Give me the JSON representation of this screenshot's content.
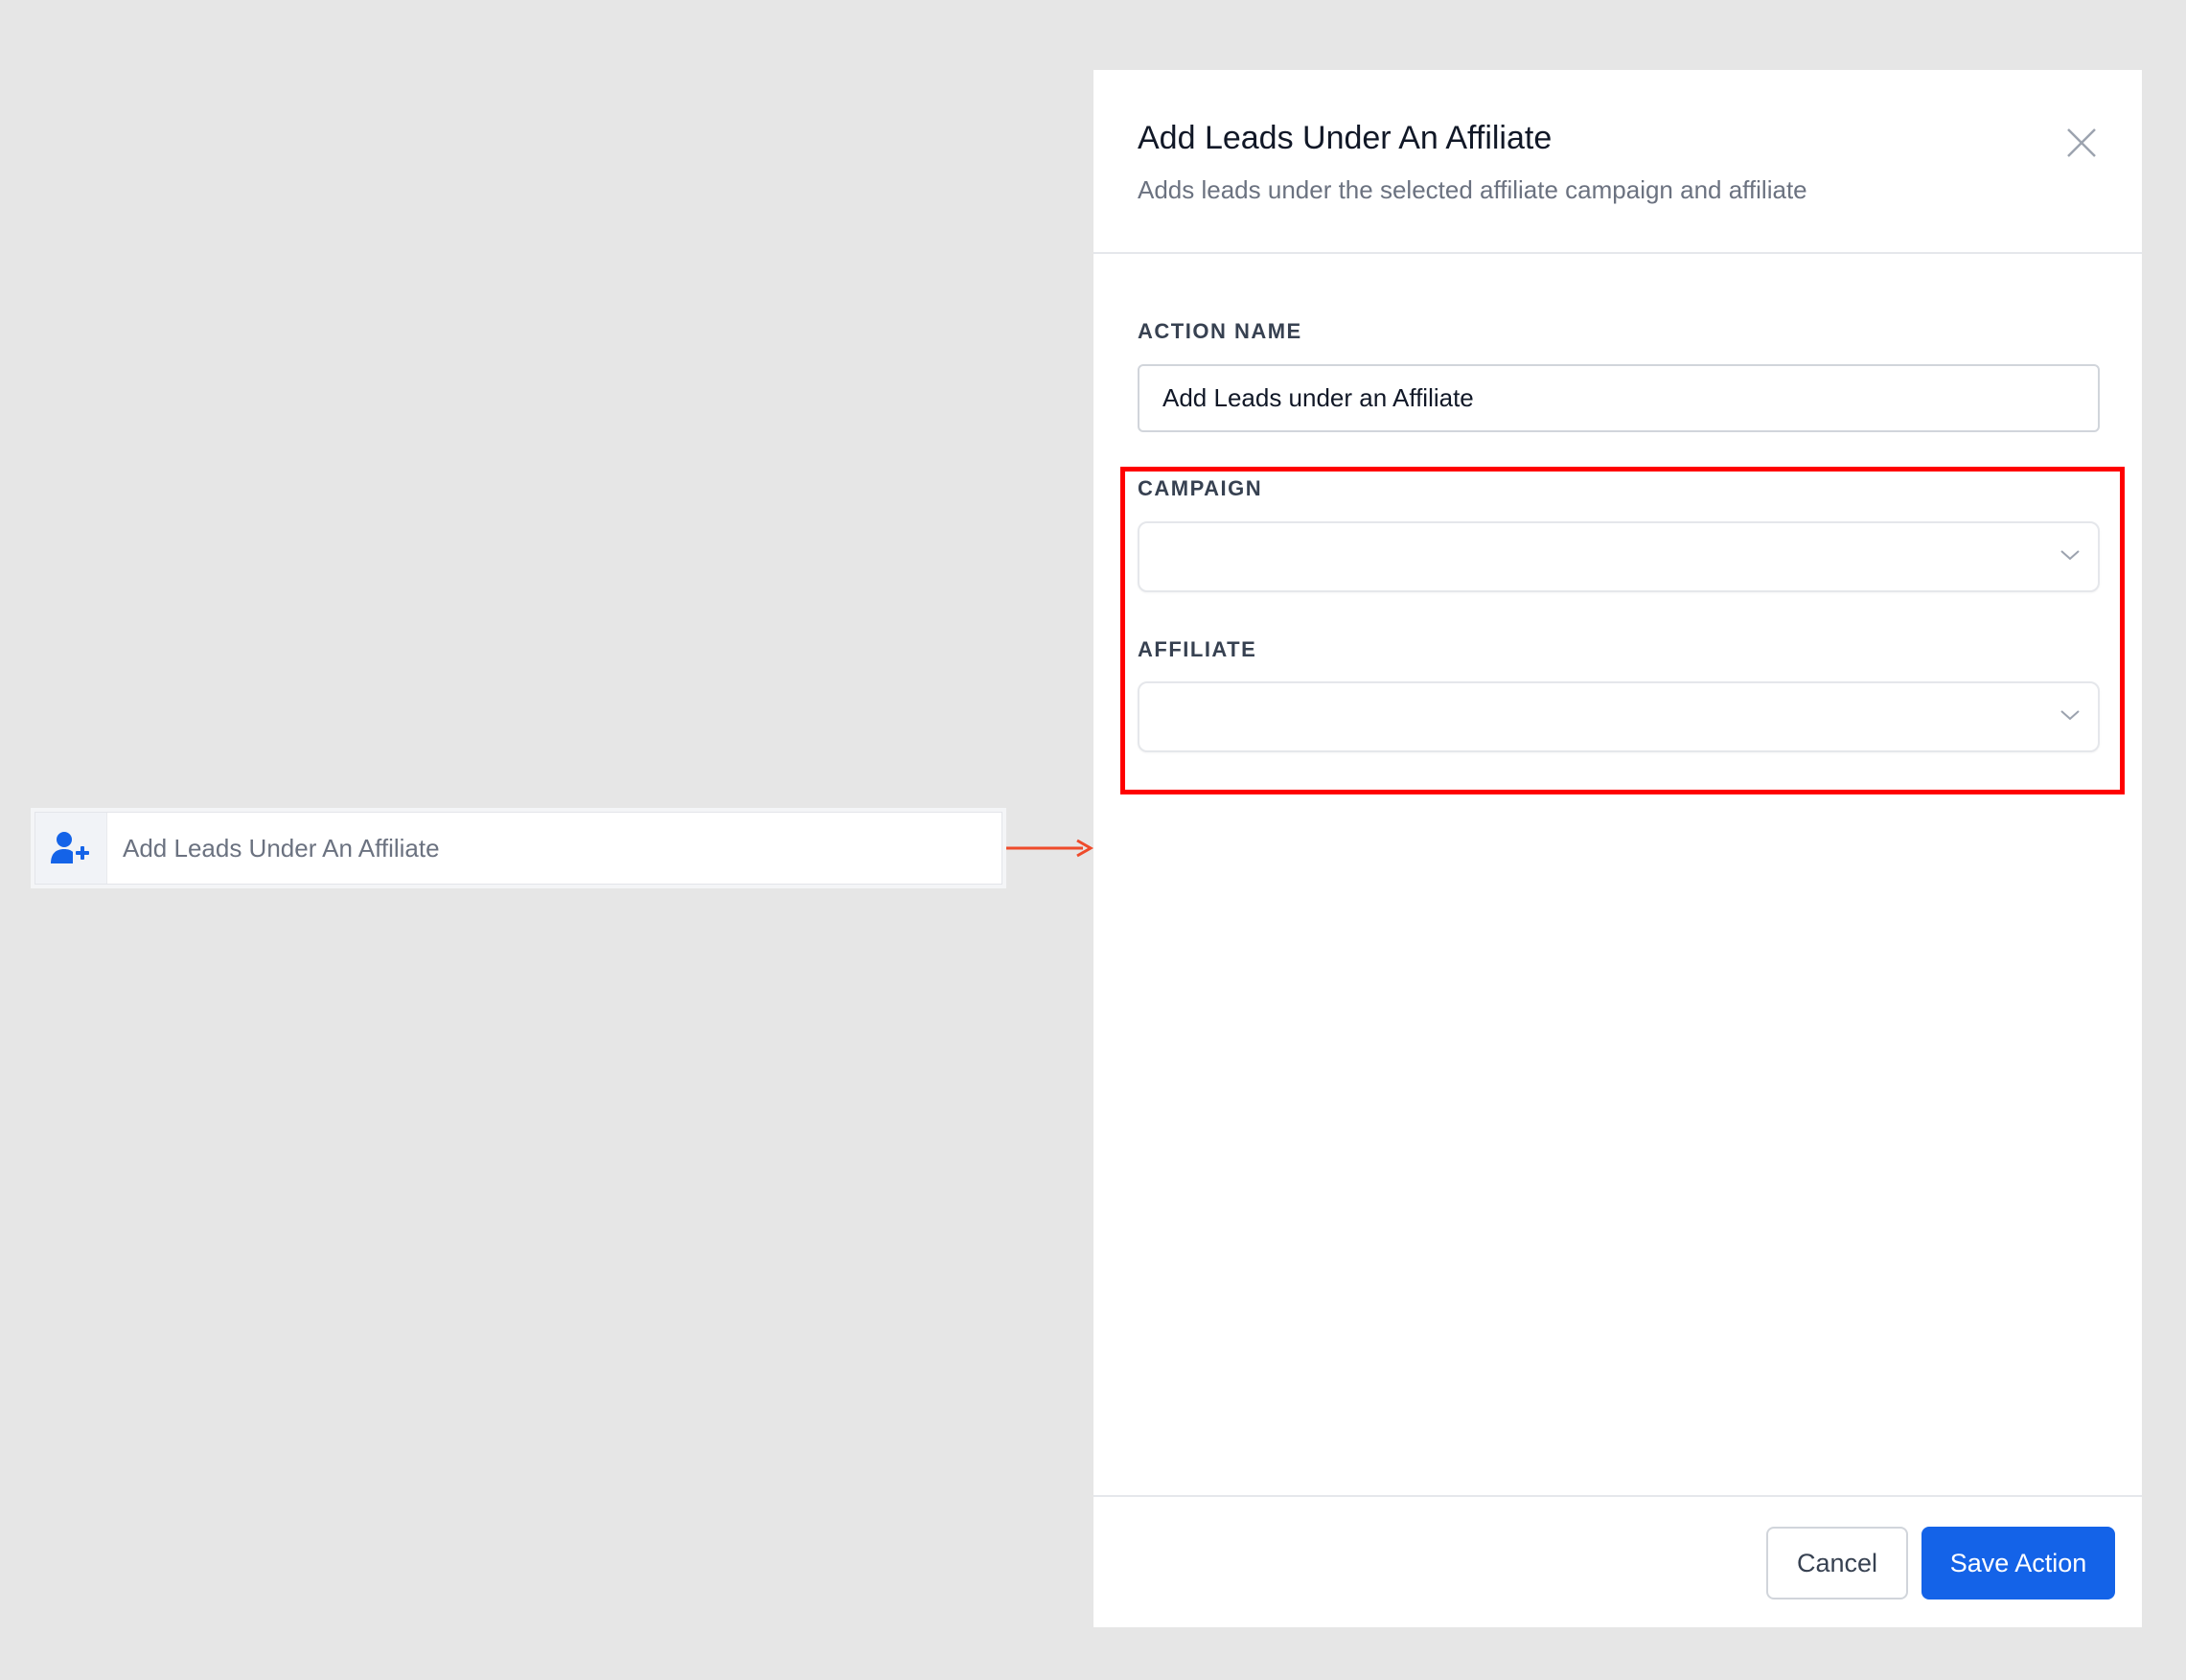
{
  "action_item": {
    "icon": "user-plus-icon",
    "label": "Add Leads Under An Affiliate"
  },
  "panel": {
    "title": "Add Leads Under An Affiliate",
    "subtitle": "Adds leads under the selected affiliate campaign and affiliate",
    "close_icon": "close-icon"
  },
  "form": {
    "action_name_label": "ACTION NAME",
    "action_name_value": "Add Leads under an Affiliate",
    "campaign_label": "CAMPAIGN",
    "campaign_value": "",
    "affiliate_label": "AFFILIATE",
    "affiliate_value": ""
  },
  "footer": {
    "cancel_label": "Cancel",
    "save_label": "Save Action"
  },
  "colors": {
    "accent": "#1463e8",
    "highlight": "#ff0000",
    "arrow": "#ef4b2b",
    "background": "#e6e6e6"
  }
}
